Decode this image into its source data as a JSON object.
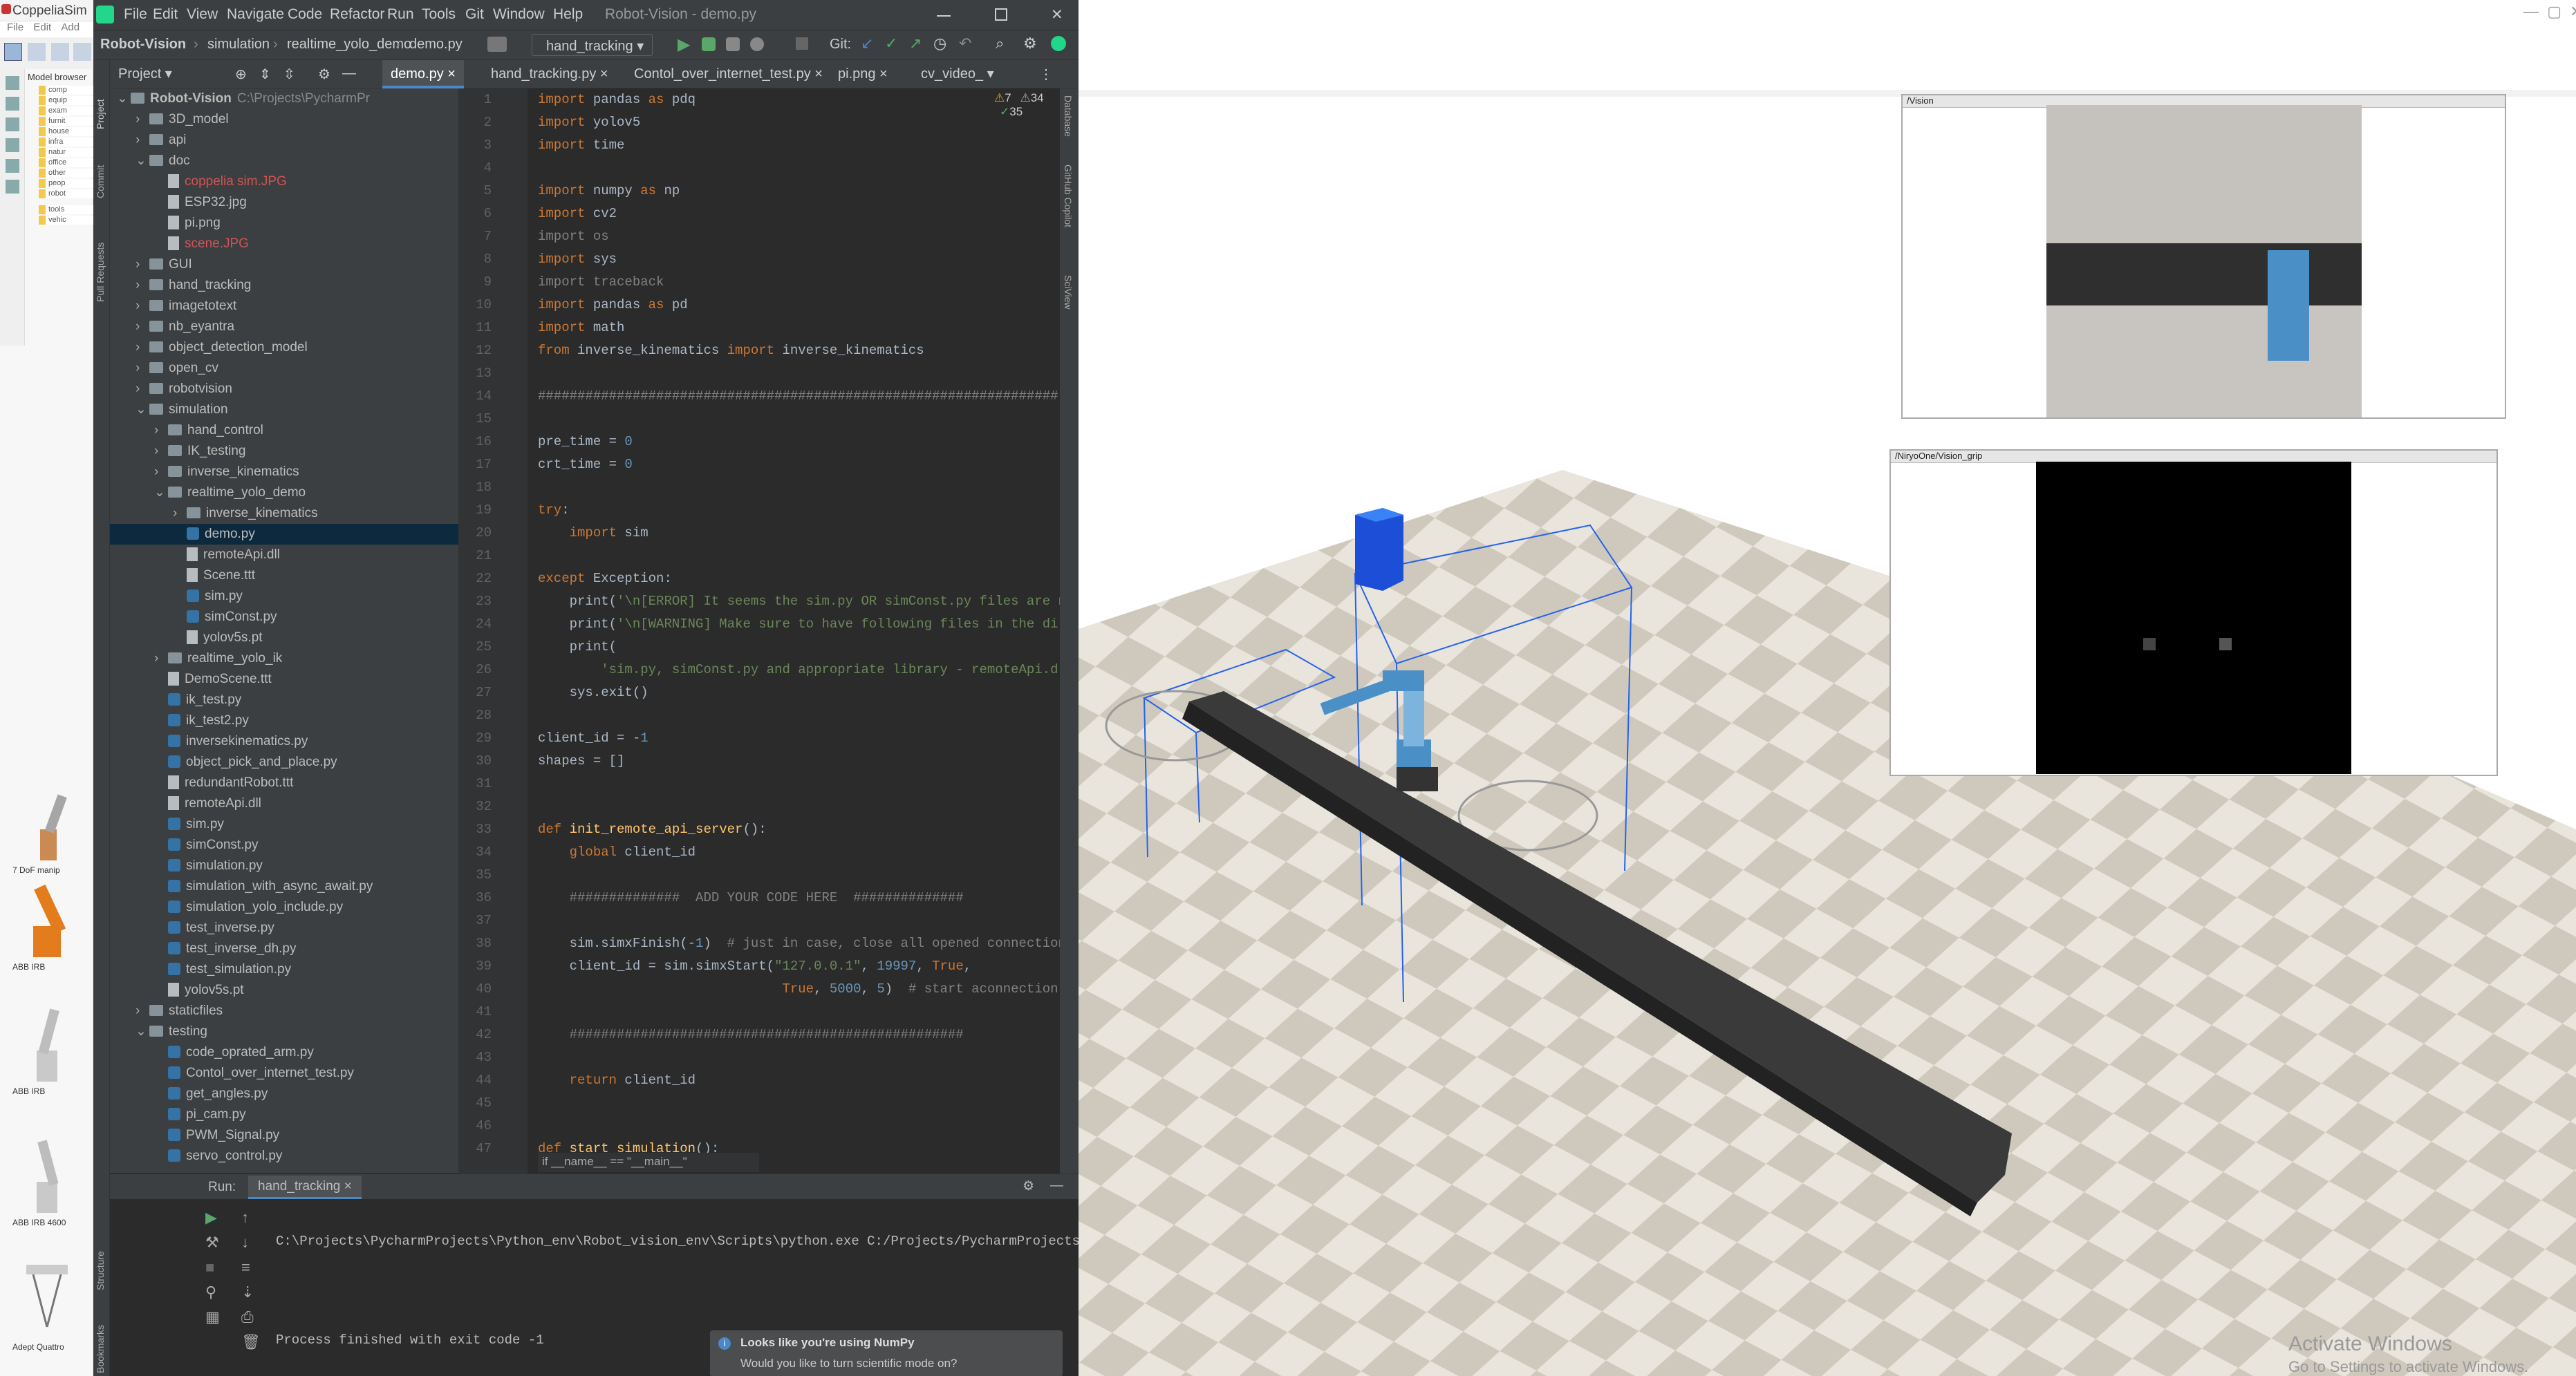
{
  "coppelia": {
    "title": "CoppeliaSim",
    "menu": [
      "File",
      "Edit",
      "Add"
    ],
    "model_browser_title": "Model browser",
    "model_tree": [
      "comp",
      "equip",
      "exam",
      "furnit",
      "house",
      "infra",
      "natur",
      "office",
      "other",
      "peop",
      "robot",
      "tools",
      "vehic"
    ],
    "thumbnails": [
      "7 DoF manip",
      "ABB IRB",
      "ABB IRB",
      "ABB IRB 4600",
      "Adept Quattro"
    ]
  },
  "ide": {
    "menu": [
      "File",
      "Edit",
      "View",
      "Navigate",
      "Code",
      "Refactor",
      "Run",
      "Tools",
      "Git",
      "Window",
      "Help"
    ],
    "window_title": "Robot-Vision - demo.py",
    "breadcrumb": [
      "Robot-Vision",
      "simulation",
      "realtime_yolo_demo",
      "demo.py"
    ],
    "run_config": "hand_tracking",
    "git_label": "Git:",
    "tabs": [
      "demo.py",
      "hand_tracking.py",
      "Contol_over_internet_test.py",
      "pi.png",
      "cv_video_"
    ],
    "project_label": "Project",
    "inspections": {
      "warnings": "7",
      "weak": "34",
      "typos": "35"
    },
    "side_tabs_left": [
      "Project",
      "Commit",
      "Pull Requests",
      "Structure",
      "Bookmarks"
    ],
    "side_tabs_right": [
      "Database",
      "GitHub Copilot",
      "SciView"
    ],
    "tree": [
      {
        "d": 0,
        "t": "f",
        "n": "Robot-Vision",
        "x": "C:\\Projects\\PycharmPr",
        "o": true,
        "b": true
      },
      {
        "d": 1,
        "t": "f",
        "n": "3D_model"
      },
      {
        "d": 1,
        "t": "f",
        "n": "api"
      },
      {
        "d": 1,
        "t": "f",
        "n": "doc",
        "o": true
      },
      {
        "d": 2,
        "t": "i",
        "n": "coppelia sim.JPG",
        "c": "#d25252"
      },
      {
        "d": 2,
        "t": "i",
        "n": "ESP32.jpg"
      },
      {
        "d": 2,
        "t": "i",
        "n": "pi.png"
      },
      {
        "d": 2,
        "t": "i",
        "n": "scene.JPG",
        "c": "#d25252"
      },
      {
        "d": 1,
        "t": "f",
        "n": "GUI"
      },
      {
        "d": 1,
        "t": "f",
        "n": "hand_tracking"
      },
      {
        "d": 1,
        "t": "f",
        "n": "imagetotext"
      },
      {
        "d": 1,
        "t": "f",
        "n": "nb_eyantra"
      },
      {
        "d": 1,
        "t": "f",
        "n": "object_detection_model"
      },
      {
        "d": 1,
        "t": "f",
        "n": "open_cv"
      },
      {
        "d": 1,
        "t": "f",
        "n": "robotvision"
      },
      {
        "d": 1,
        "t": "f",
        "n": "simulation",
        "o": true
      },
      {
        "d": 2,
        "t": "f",
        "n": "hand_control"
      },
      {
        "d": 2,
        "t": "f",
        "n": "IK_testing"
      },
      {
        "d": 2,
        "t": "f",
        "n": "inverse_kinematics"
      },
      {
        "d": 2,
        "t": "f",
        "n": "realtime_yolo_demo",
        "o": true
      },
      {
        "d": 3,
        "t": "f",
        "n": "inverse_kinematics"
      },
      {
        "d": 3,
        "t": "p",
        "n": "demo.py",
        "s": true
      },
      {
        "d": 3,
        "t": "i",
        "n": "remoteApi.dll"
      },
      {
        "d": 3,
        "t": "i",
        "n": "Scene.ttt"
      },
      {
        "d": 3,
        "t": "p",
        "n": "sim.py"
      },
      {
        "d": 3,
        "t": "p",
        "n": "simConst.py"
      },
      {
        "d": 3,
        "t": "i",
        "n": "yolov5s.pt"
      },
      {
        "d": 2,
        "t": "f",
        "n": "realtime_yolo_ik"
      },
      {
        "d": 2,
        "t": "i",
        "n": "DemoScene.ttt"
      },
      {
        "d": 2,
        "t": "p",
        "n": "ik_test.py"
      },
      {
        "d": 2,
        "t": "p",
        "n": "ik_test2.py"
      },
      {
        "d": 2,
        "t": "p",
        "n": "inversekinematics.py"
      },
      {
        "d": 2,
        "t": "p",
        "n": "object_pick_and_place.py"
      },
      {
        "d": 2,
        "t": "i",
        "n": "redundantRobot.ttt"
      },
      {
        "d": 2,
        "t": "i",
        "n": "remoteApi.dll"
      },
      {
        "d": 2,
        "t": "p",
        "n": "sim.py"
      },
      {
        "d": 2,
        "t": "p",
        "n": "simConst.py"
      },
      {
        "d": 2,
        "t": "p",
        "n": "simulation.py"
      },
      {
        "d": 2,
        "t": "p",
        "n": "simulation_with_async_await.py"
      },
      {
        "d": 2,
        "t": "p",
        "n": "simulation_yolo_include.py"
      },
      {
        "d": 2,
        "t": "p",
        "n": "test_inverse.py"
      },
      {
        "d": 2,
        "t": "p",
        "n": "test_inverse_dh.py"
      },
      {
        "d": 2,
        "t": "p",
        "n": "test_simulation.py"
      },
      {
        "d": 2,
        "t": "i",
        "n": "yolov5s.pt"
      },
      {
        "d": 1,
        "t": "f",
        "n": "staticfiles"
      },
      {
        "d": 1,
        "t": "f",
        "n": "testing",
        "o": true
      },
      {
        "d": 2,
        "t": "p",
        "n": "code_oprated_arm.py"
      },
      {
        "d": 2,
        "t": "p",
        "n": "Contol_over_internet_test.py"
      },
      {
        "d": 2,
        "t": "p",
        "n": "get_angles.py"
      },
      {
        "d": 2,
        "t": "p",
        "n": "pi_cam.py"
      },
      {
        "d": 2,
        "t": "p",
        "n": "PWM_Signal.py"
      },
      {
        "d": 2,
        "t": "p",
        "n": "servo_control.py"
      }
    ],
    "code": [
      [
        [
          "kw",
          "import"
        ],
        [
          "df",
          " pandas "
        ],
        [
          "kw",
          "as"
        ],
        [
          "df",
          " pdq"
        ]
      ],
      [
        [
          "kw",
          "import"
        ],
        [
          "df",
          " yolov5"
        ]
      ],
      [
        [
          "kw",
          "import"
        ],
        [
          "df",
          " time"
        ]
      ],
      [],
      [
        [
          "kw",
          "import"
        ],
        [
          "df",
          " numpy "
        ],
        [
          "kw",
          "as"
        ],
        [
          "df",
          " np"
        ]
      ],
      [
        [
          "kw",
          "import"
        ],
        [
          "df",
          " cv2"
        ]
      ],
      [
        [
          "cm",
          "import os"
        ]
      ],
      [
        [
          "kw",
          "import"
        ],
        [
          "df",
          " sys"
        ]
      ],
      [
        [
          "cm",
          "import traceback"
        ]
      ],
      [
        [
          "kw",
          "import"
        ],
        [
          "df",
          " pandas "
        ],
        [
          "kw",
          "as"
        ],
        [
          "df",
          " pd"
        ]
      ],
      [
        [
          "kw",
          "import"
        ],
        [
          "df",
          " math"
        ]
      ],
      [
        [
          "kw",
          "from"
        ],
        [
          "df",
          " inverse_kinematics "
        ],
        [
          "kw",
          "import"
        ],
        [
          "df",
          " inverse_kinematics"
        ]
      ],
      [],
      [
        [
          "cm",
          "##################################################################"
        ]
      ],
      [],
      [
        [
          "df",
          "pre_time = "
        ],
        [
          "nm",
          "0"
        ]
      ],
      [
        [
          "df",
          "crt_time = "
        ],
        [
          "nm",
          "0"
        ]
      ],
      [],
      [
        [
          "kw",
          "try"
        ],
        [
          "df",
          ":"
        ]
      ],
      [
        [
          "df",
          "    "
        ],
        [
          "kw",
          "import"
        ],
        [
          "df",
          " sim"
        ]
      ],
      [],
      [
        [
          "kw",
          "except"
        ],
        [
          "df",
          " Exception:"
        ]
      ],
      [
        [
          "df",
          "    print("
        ],
        [
          "st",
          "'\\n[ERROR] It seems the sim.py OR simConst.py files are not fou"
        ]
      ],
      [
        [
          "df",
          "    print("
        ],
        [
          "st",
          "'\\n[WARNING] Make sure to have following files in the directory"
        ]
      ],
      [
        [
          "df",
          "    print("
        ]
      ],
      [
        [
          "st",
          "        'sim.py, simConst.py and appropriate library - remoteApi.dll (if "
        ]
      ],
      [
        [
          "df",
          "    sys.exit()"
        ]
      ],
      [],
      [
        [
          "df",
          "client_id = -"
        ],
        [
          "nm",
          "1"
        ]
      ],
      [
        [
          "df",
          "shapes = []"
        ]
      ],
      [],
      [],
      [
        [
          "kw",
          "def"
        ],
        [
          "fn",
          " init_remote_api_server"
        ],
        [
          "df",
          "():"
        ]
      ],
      [
        [
          "df",
          "    "
        ],
        [
          "kw",
          "global"
        ],
        [
          "df",
          " client_id"
        ]
      ],
      [],
      [
        [
          "cm",
          "    ##############  ADD YOUR CODE HERE  ##############"
        ]
      ],
      [],
      [
        [
          "df",
          "    sim.simxFinish(-"
        ],
        [
          "nm",
          "1"
        ],
        [
          "df",
          ")  "
        ],
        [
          "cm",
          "# just in case, close all opened connections"
        ]
      ],
      [
        [
          "df",
          "    client_id = sim.simxStart("
        ],
        [
          "st",
          "\"127.0.0.1\""
        ],
        [
          "df",
          ", "
        ],
        [
          "nm",
          "19997"
        ],
        [
          "df",
          ", "
        ],
        [
          "kw",
          "True"
        ],
        [
          "df",
          ","
        ]
      ],
      [
        [
          "df",
          "                               "
        ],
        [
          "kw",
          "True"
        ],
        [
          "df",
          ", "
        ],
        [
          "nm",
          "5000"
        ],
        [
          "df",
          ", "
        ],
        [
          "nm",
          "5"
        ],
        [
          "df",
          ")  "
        ],
        [
          "cm",
          "# start aconnection"
        ]
      ],
      [],
      [
        [
          "cm",
          "    ##################################################"
        ]
      ],
      [],
      [
        [
          "df",
          "    "
        ],
        [
          "kw",
          "return"
        ],
        [
          "df",
          " client_id"
        ]
      ],
      [],
      [],
      [
        [
          "kw",
          "def"
        ],
        [
          "fn",
          " start_simulation"
        ],
        [
          "df",
          "():"
        ]
      ]
    ],
    "breadcrumb_bottom": "if __name__ == \"__main__\"",
    "run_label": "Run:",
    "run_tab": "hand_tracking",
    "console": [
      "C:\\Projects\\PycharmProjects\\Python_env\\Robot_vision_env\\Scripts\\python.exe C:/Projects/PycharmProjects/Ro",
      "",
      "Process finished with exit code -1"
    ],
    "notification": {
      "title": "Looks like you're using NumPy",
      "body": "Would you like to turn scientific mode on?"
    }
  },
  "scene": {
    "vision_title": "/Vision",
    "vision_grip_title": "/NiryoOne/Vision_grip",
    "activate_title": "Activate Windows",
    "activate_body": "Go to Settings to activate Windows."
  }
}
